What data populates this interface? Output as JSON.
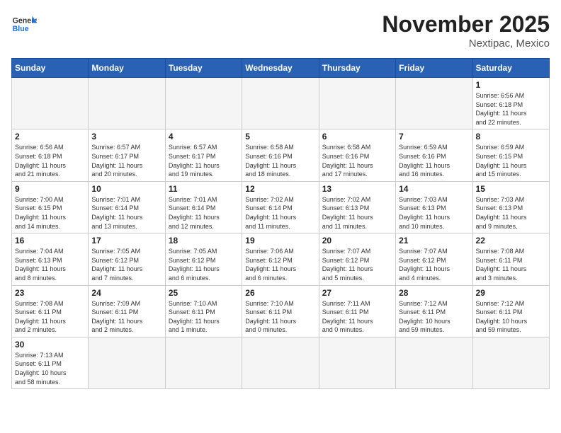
{
  "header": {
    "logo_general": "General",
    "logo_blue": "Blue",
    "month": "November 2025",
    "location": "Nextipac, Mexico"
  },
  "days_of_week": [
    "Sunday",
    "Monday",
    "Tuesday",
    "Wednesday",
    "Thursday",
    "Friday",
    "Saturday"
  ],
  "weeks": [
    [
      {
        "day": "",
        "info": ""
      },
      {
        "day": "",
        "info": ""
      },
      {
        "day": "",
        "info": ""
      },
      {
        "day": "",
        "info": ""
      },
      {
        "day": "",
        "info": ""
      },
      {
        "day": "",
        "info": ""
      },
      {
        "day": "1",
        "info": "Sunrise: 6:56 AM\nSunset: 6:18 PM\nDaylight: 11 hours\nand 22 minutes."
      }
    ],
    [
      {
        "day": "2",
        "info": "Sunrise: 6:56 AM\nSunset: 6:18 PM\nDaylight: 11 hours\nand 21 minutes."
      },
      {
        "day": "3",
        "info": "Sunrise: 6:57 AM\nSunset: 6:17 PM\nDaylight: 11 hours\nand 20 minutes."
      },
      {
        "day": "4",
        "info": "Sunrise: 6:57 AM\nSunset: 6:17 PM\nDaylight: 11 hours\nand 19 minutes."
      },
      {
        "day": "5",
        "info": "Sunrise: 6:58 AM\nSunset: 6:16 PM\nDaylight: 11 hours\nand 18 minutes."
      },
      {
        "day": "6",
        "info": "Sunrise: 6:58 AM\nSunset: 6:16 PM\nDaylight: 11 hours\nand 17 minutes."
      },
      {
        "day": "7",
        "info": "Sunrise: 6:59 AM\nSunset: 6:16 PM\nDaylight: 11 hours\nand 16 minutes."
      },
      {
        "day": "8",
        "info": "Sunrise: 6:59 AM\nSunset: 6:15 PM\nDaylight: 11 hours\nand 15 minutes."
      }
    ],
    [
      {
        "day": "9",
        "info": "Sunrise: 7:00 AM\nSunset: 6:15 PM\nDaylight: 11 hours\nand 14 minutes."
      },
      {
        "day": "10",
        "info": "Sunrise: 7:01 AM\nSunset: 6:14 PM\nDaylight: 11 hours\nand 13 minutes."
      },
      {
        "day": "11",
        "info": "Sunrise: 7:01 AM\nSunset: 6:14 PM\nDaylight: 11 hours\nand 12 minutes."
      },
      {
        "day": "12",
        "info": "Sunrise: 7:02 AM\nSunset: 6:14 PM\nDaylight: 11 hours\nand 11 minutes."
      },
      {
        "day": "13",
        "info": "Sunrise: 7:02 AM\nSunset: 6:13 PM\nDaylight: 11 hours\nand 11 minutes."
      },
      {
        "day": "14",
        "info": "Sunrise: 7:03 AM\nSunset: 6:13 PM\nDaylight: 11 hours\nand 10 minutes."
      },
      {
        "day": "15",
        "info": "Sunrise: 7:03 AM\nSunset: 6:13 PM\nDaylight: 11 hours\nand 9 minutes."
      }
    ],
    [
      {
        "day": "16",
        "info": "Sunrise: 7:04 AM\nSunset: 6:13 PM\nDaylight: 11 hours\nand 8 minutes."
      },
      {
        "day": "17",
        "info": "Sunrise: 7:05 AM\nSunset: 6:12 PM\nDaylight: 11 hours\nand 7 minutes."
      },
      {
        "day": "18",
        "info": "Sunrise: 7:05 AM\nSunset: 6:12 PM\nDaylight: 11 hours\nand 6 minutes."
      },
      {
        "day": "19",
        "info": "Sunrise: 7:06 AM\nSunset: 6:12 PM\nDaylight: 11 hours\nand 6 minutes."
      },
      {
        "day": "20",
        "info": "Sunrise: 7:07 AM\nSunset: 6:12 PM\nDaylight: 11 hours\nand 5 minutes."
      },
      {
        "day": "21",
        "info": "Sunrise: 7:07 AM\nSunset: 6:12 PM\nDaylight: 11 hours\nand 4 minutes."
      },
      {
        "day": "22",
        "info": "Sunrise: 7:08 AM\nSunset: 6:11 PM\nDaylight: 11 hours\nand 3 minutes."
      }
    ],
    [
      {
        "day": "23",
        "info": "Sunrise: 7:08 AM\nSunset: 6:11 PM\nDaylight: 11 hours\nand 2 minutes."
      },
      {
        "day": "24",
        "info": "Sunrise: 7:09 AM\nSunset: 6:11 PM\nDaylight: 11 hours\nand 2 minutes."
      },
      {
        "day": "25",
        "info": "Sunrise: 7:10 AM\nSunset: 6:11 PM\nDaylight: 11 hours\nand 1 minute."
      },
      {
        "day": "26",
        "info": "Sunrise: 7:10 AM\nSunset: 6:11 PM\nDaylight: 11 hours\nand 0 minutes."
      },
      {
        "day": "27",
        "info": "Sunrise: 7:11 AM\nSunset: 6:11 PM\nDaylight: 11 hours\nand 0 minutes."
      },
      {
        "day": "28",
        "info": "Sunrise: 7:12 AM\nSunset: 6:11 PM\nDaylight: 10 hours\nand 59 minutes."
      },
      {
        "day": "29",
        "info": "Sunrise: 7:12 AM\nSunset: 6:11 PM\nDaylight: 10 hours\nand 59 minutes."
      }
    ],
    [
      {
        "day": "30",
        "info": "Sunrise: 7:13 AM\nSunset: 6:11 PM\nDaylight: 10 hours\nand 58 minutes."
      },
      {
        "day": "",
        "info": ""
      },
      {
        "day": "",
        "info": ""
      },
      {
        "day": "",
        "info": ""
      },
      {
        "day": "",
        "info": ""
      },
      {
        "day": "",
        "info": ""
      },
      {
        "day": "",
        "info": ""
      }
    ]
  ]
}
